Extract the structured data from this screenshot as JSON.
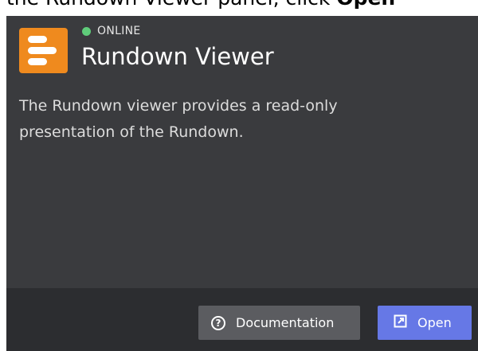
{
  "top_strip": {
    "text": "the Rundown Viewer panel, click",
    "bold_text": "Open"
  },
  "card": {
    "status": {
      "label": "ONLINE",
      "color": "#5fcc7a"
    },
    "title": "Rundown Viewer",
    "description": "The Rundown viewer provides a read-only presentation of the Rundown.",
    "app_icon": "rundown-list-icon",
    "app_icon_color": "#ef8a1e"
  },
  "footer": {
    "documentation_button": {
      "label": "Documentation",
      "icon": "help-circle-icon"
    },
    "open_button": {
      "label": "Open",
      "icon": "external-link-icon",
      "color": "#6678e6"
    }
  }
}
